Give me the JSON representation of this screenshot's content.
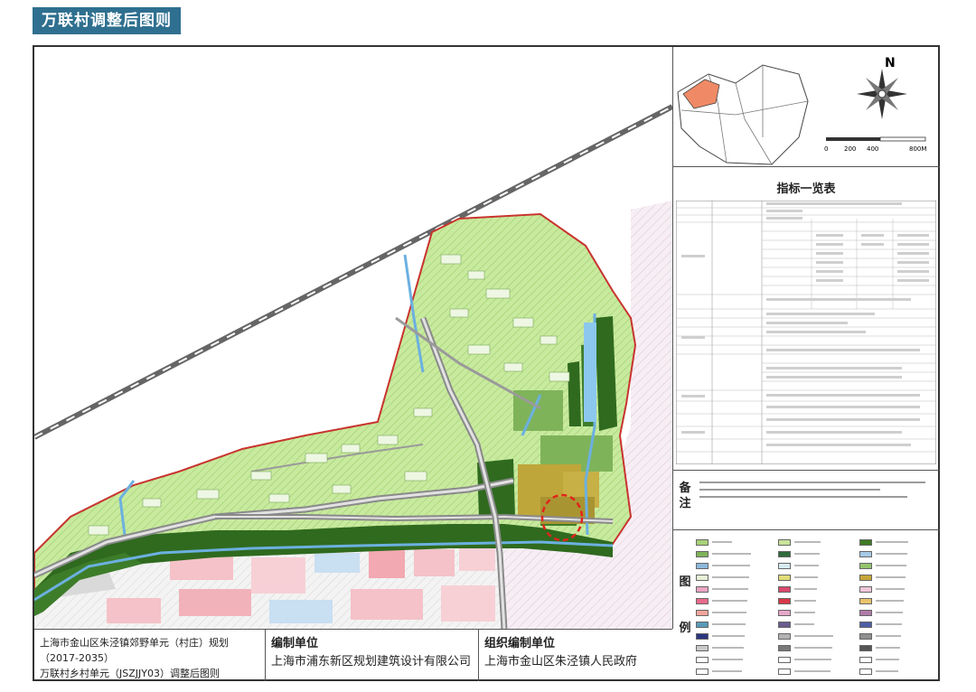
{
  "header": {
    "title": "万联村调整后图则"
  },
  "inset_map": {
    "scale_ticks": [
      "0",
      "200",
      "400",
      "800M"
    ],
    "north_label": "N"
  },
  "index_table": {
    "title": "指标一览表"
  },
  "notes": {
    "label": "备\n注"
  },
  "legend": {
    "label": "图\n\n\n例",
    "colors": [
      "#a8d279",
      "#c9e39a",
      "#3f7a24",
      "#7fb35a",
      "#2f6a3c",
      "#a6c9e6",
      "#8cb8dd",
      "#d7ecf5",
      "#93c46e",
      "#e8f2d8",
      "#e2dd76",
      "#c7a63a",
      "#e9a6c3",
      "#d9496c",
      "#f0c6d8",
      "#e86a8a",
      "#d8394a",
      "#e7c36a",
      "#f2a49c",
      "#e6a7c9",
      "#b07aa8",
      "#5a9ab8",
      "#6b5b8f",
      "#4f5fa6",
      "#2a3580",
      "#b3b3b3",
      "#8f8f8f",
      "#c9c9c9",
      "#7a7a7a",
      "#555555",
      "#ffffff",
      "#ffffff",
      "#ffffff",
      "#ffffff",
      "#ffffff",
      "#ffffff"
    ]
  },
  "footer": {
    "plan_title_1": "上海市金山区朱泾镇郊野单元（村庄）规划（2017-2035）",
    "plan_title_2": "万联村乡村单元（JSZJJY03）调整后图则",
    "editor_label": "编制单位",
    "editor_org": "上海市浦东新区规划建筑设计有限公司",
    "organizer_label": "组织编制单位",
    "organizer_org": "上海市金山区朱泾镇人民政府"
  }
}
